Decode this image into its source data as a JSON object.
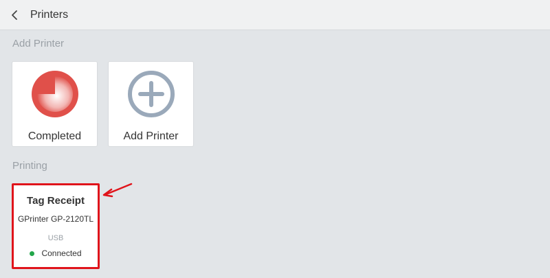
{
  "header": {
    "back_icon": "chevron-left-icon",
    "title": "Printers"
  },
  "add_section": {
    "label": "Add Printer",
    "tiles": [
      {
        "label": "Completed",
        "icon": "completed-progress-icon",
        "color": "#e0504a"
      },
      {
        "label": "Add Printer",
        "icon": "plus-circle-icon",
        "color": "#9aa9ba"
      }
    ]
  },
  "printing_section": {
    "label": "Printing",
    "printer": {
      "name": "Tag Receipt",
      "model": "GPrinter GP-2120TL",
      "connection": "USB",
      "status": "Connected",
      "status_color": "#22a64a"
    }
  },
  "annotation": {
    "highlight_color": "#e0141b"
  }
}
